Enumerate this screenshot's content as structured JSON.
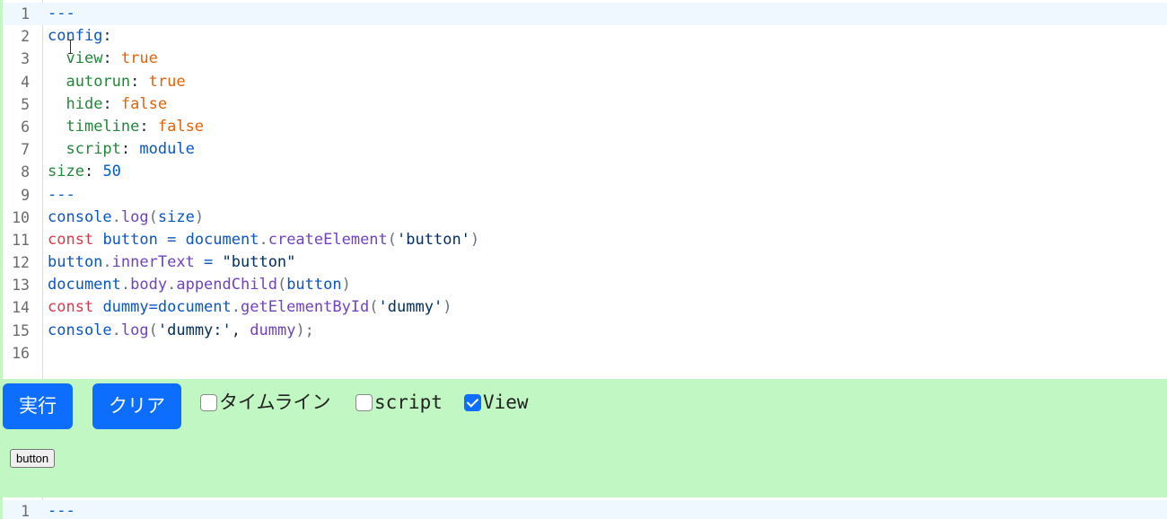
{
  "editor_top": {
    "lines": [
      {
        "n": "1",
        "tokens": [
          {
            "t": "---",
            "c": "c-blue"
          }
        ]
      },
      {
        "n": "2",
        "tokens": [
          {
            "t": "config",
            "c": "c-id"
          },
          {
            "t": ":",
            "c": "c-plain"
          }
        ]
      },
      {
        "n": "3",
        "tokens": [
          {
            "t": "  ",
            "c": "c-plain"
          },
          {
            "t": "view",
            "c": "c-key"
          },
          {
            "t": ": ",
            "c": "c-plain"
          },
          {
            "t": "true",
            "c": "c-bool"
          }
        ]
      },
      {
        "n": "4",
        "tokens": [
          {
            "t": "  ",
            "c": "c-plain"
          },
          {
            "t": "autorun",
            "c": "c-key"
          },
          {
            "t": ": ",
            "c": "c-plain"
          },
          {
            "t": "true",
            "c": "c-bool"
          }
        ]
      },
      {
        "n": "5",
        "tokens": [
          {
            "t": "  ",
            "c": "c-plain"
          },
          {
            "t": "hide",
            "c": "c-key"
          },
          {
            "t": ": ",
            "c": "c-plain"
          },
          {
            "t": "false",
            "c": "c-bool"
          }
        ]
      },
      {
        "n": "6",
        "tokens": [
          {
            "t": "  ",
            "c": "c-plain"
          },
          {
            "t": "timeline",
            "c": "c-key"
          },
          {
            "t": ": ",
            "c": "c-plain"
          },
          {
            "t": "false",
            "c": "c-bool"
          }
        ]
      },
      {
        "n": "7",
        "tokens": [
          {
            "t": "  ",
            "c": "c-plain"
          },
          {
            "t": "script",
            "c": "c-key"
          },
          {
            "t": ": ",
            "c": "c-plain"
          },
          {
            "t": "module",
            "c": "c-id"
          }
        ]
      },
      {
        "n": "8",
        "tokens": [
          {
            "t": "size",
            "c": "c-key"
          },
          {
            "t": ": ",
            "c": "c-plain"
          },
          {
            "t": "50",
            "c": "c-blue"
          }
        ]
      },
      {
        "n": "9",
        "tokens": [
          {
            "t": "---",
            "c": "c-blue"
          }
        ]
      },
      {
        "n": "10",
        "tokens": [
          {
            "t": "console",
            "c": "c-id"
          },
          {
            "t": ".",
            "c": "c-punc"
          },
          {
            "t": "log",
            "c": "c-meth"
          },
          {
            "t": "(",
            "c": "c-punc"
          },
          {
            "t": "size",
            "c": "c-id"
          },
          {
            "t": ")",
            "c": "c-punc"
          }
        ]
      },
      {
        "n": "11",
        "tokens": [
          {
            "t": "const",
            "c": "c-kw"
          },
          {
            "t": " ",
            "c": "c-plain"
          },
          {
            "t": "button",
            "c": "c-id"
          },
          {
            "t": " = ",
            "c": "c-id"
          },
          {
            "t": "document",
            "c": "c-id"
          },
          {
            "t": ".",
            "c": "c-punc"
          },
          {
            "t": "createElement",
            "c": "c-meth"
          },
          {
            "t": "(",
            "c": "c-punc"
          },
          {
            "t": "'button'",
            "c": "c-str"
          },
          {
            "t": ")",
            "c": "c-punc"
          }
        ]
      },
      {
        "n": "12",
        "tokens": [
          {
            "t": "button",
            "c": "c-id"
          },
          {
            "t": ".",
            "c": "c-punc"
          },
          {
            "t": "innerText",
            "c": "c-meth"
          },
          {
            "t": " = ",
            "c": "c-id"
          },
          {
            "t": "\"button\"",
            "c": "c-str"
          }
        ]
      },
      {
        "n": "13",
        "tokens": [
          {
            "t": "document",
            "c": "c-id"
          },
          {
            "t": ".",
            "c": "c-punc"
          },
          {
            "t": "body",
            "c": "c-meth"
          },
          {
            "t": ".",
            "c": "c-punc"
          },
          {
            "t": "appendChild",
            "c": "c-meth"
          },
          {
            "t": "(",
            "c": "c-punc"
          },
          {
            "t": "button",
            "c": "c-id"
          },
          {
            "t": ")",
            "c": "c-punc"
          }
        ]
      },
      {
        "n": "14",
        "tokens": [
          {
            "t": "const",
            "c": "c-kw"
          },
          {
            "t": " ",
            "c": "c-plain"
          },
          {
            "t": "dummy=document",
            "c": "c-id"
          },
          {
            "t": ".",
            "c": "c-punc"
          },
          {
            "t": "getElementById",
            "c": "c-meth"
          },
          {
            "t": "(",
            "c": "c-punc"
          },
          {
            "t": "'dummy'",
            "c": "c-str"
          },
          {
            "t": ")",
            "c": "c-punc"
          }
        ]
      },
      {
        "n": "15",
        "tokens": [
          {
            "t": "console",
            "c": "c-id"
          },
          {
            "t": ".",
            "c": "c-punc"
          },
          {
            "t": "log",
            "c": "c-meth"
          },
          {
            "t": "(",
            "c": "c-punc"
          },
          {
            "t": "'dummy:'",
            "c": "c-str"
          },
          {
            "t": ", ",
            "c": "c-plain"
          },
          {
            "t": "dummy",
            "c": "c-meth"
          },
          {
            "t": ");",
            "c": "c-punc"
          }
        ]
      },
      {
        "n": "16",
        "tokens": []
      }
    ]
  },
  "controls": {
    "run_label": "実行",
    "clear_label": "クリア",
    "timeline_label": "タイムライン",
    "timeline_checked": false,
    "script_label": "script",
    "script_checked": false,
    "view_label": "View",
    "view_checked": true
  },
  "output": {
    "button_label": "button"
  },
  "editor_bottom": {
    "lines": [
      {
        "n": "1",
        "tokens": [
          {
            "t": "---",
            "c": "c-blue"
          }
        ]
      }
    ]
  },
  "colors": {
    "panel_bg": "#c1f7c3",
    "button_primary": "#0d6efd",
    "active_line": "#eef8fe"
  }
}
